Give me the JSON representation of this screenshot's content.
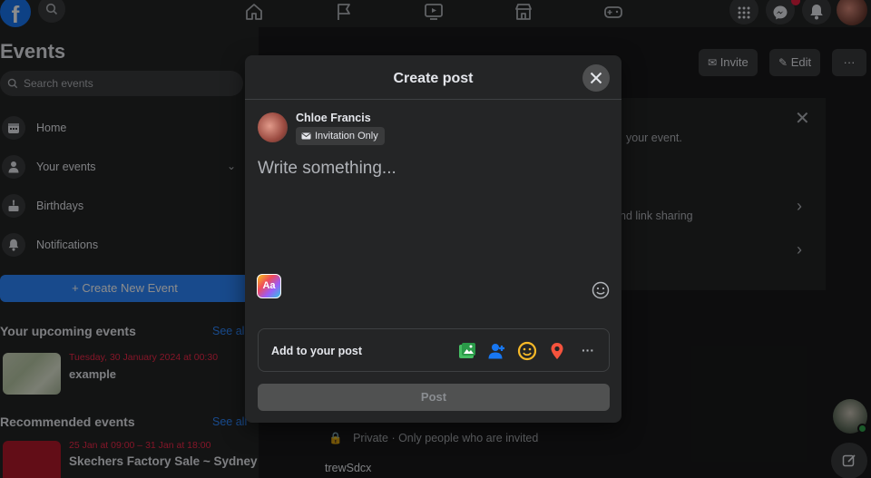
{
  "nav": {
    "logo": "f",
    "icons": [
      "search-icon",
      "home-icon",
      "flag-icon",
      "video-icon",
      "marketplace-icon",
      "gaming-icon",
      "menu-grid-icon",
      "messenger-icon",
      "notifications-icon"
    ]
  },
  "sidebar": {
    "title": "Events",
    "search_placeholder": "Search events",
    "items": [
      {
        "label": "Home",
        "icon": "calendar-icon"
      },
      {
        "label": "Your events",
        "icon": "person-icon"
      },
      {
        "label": "Birthdays",
        "icon": "cake-icon"
      },
      {
        "label": "Notifications",
        "icon": "bell-icon"
      }
    ],
    "create_button": "+  Create New Event",
    "upcoming": {
      "title": "Your upcoming events",
      "see_all": "See all",
      "event": {
        "date": "Tuesday, 30 January 2024 at 00:30",
        "name": "example"
      }
    },
    "recommended": {
      "title": "Recommended events",
      "see_all": "See all",
      "event": {
        "date": "25 Jan at 09:00 – 31 Jan at 18:00",
        "name": "Skechers Factory Sale ~ Sydney"
      }
    }
  },
  "main": {
    "toolbar": {
      "invite": "Invite",
      "edit": "Edit",
      "more": "···"
    },
    "card_text": {
      "line1": "your event.",
      "line2": "nd link sharing"
    },
    "privacy_line": "Private · Only people who are invited",
    "host_line": "trewSdcx"
  },
  "dialog": {
    "title": "Create post",
    "author": "Chloe Francis",
    "audience": "Invitation Only",
    "placeholder": "Write something...",
    "aa_label": "Aa",
    "add_to_post": "Add to your post",
    "add_icons": [
      "photo-video-icon",
      "tag-people-icon",
      "feeling-icon",
      "check-in-icon",
      "more-icon"
    ],
    "post_button": "Post"
  },
  "colors": {
    "background": "#18191a",
    "surface": "#242526",
    "accent": "#2d88ff",
    "date_red": "#f02849"
  }
}
